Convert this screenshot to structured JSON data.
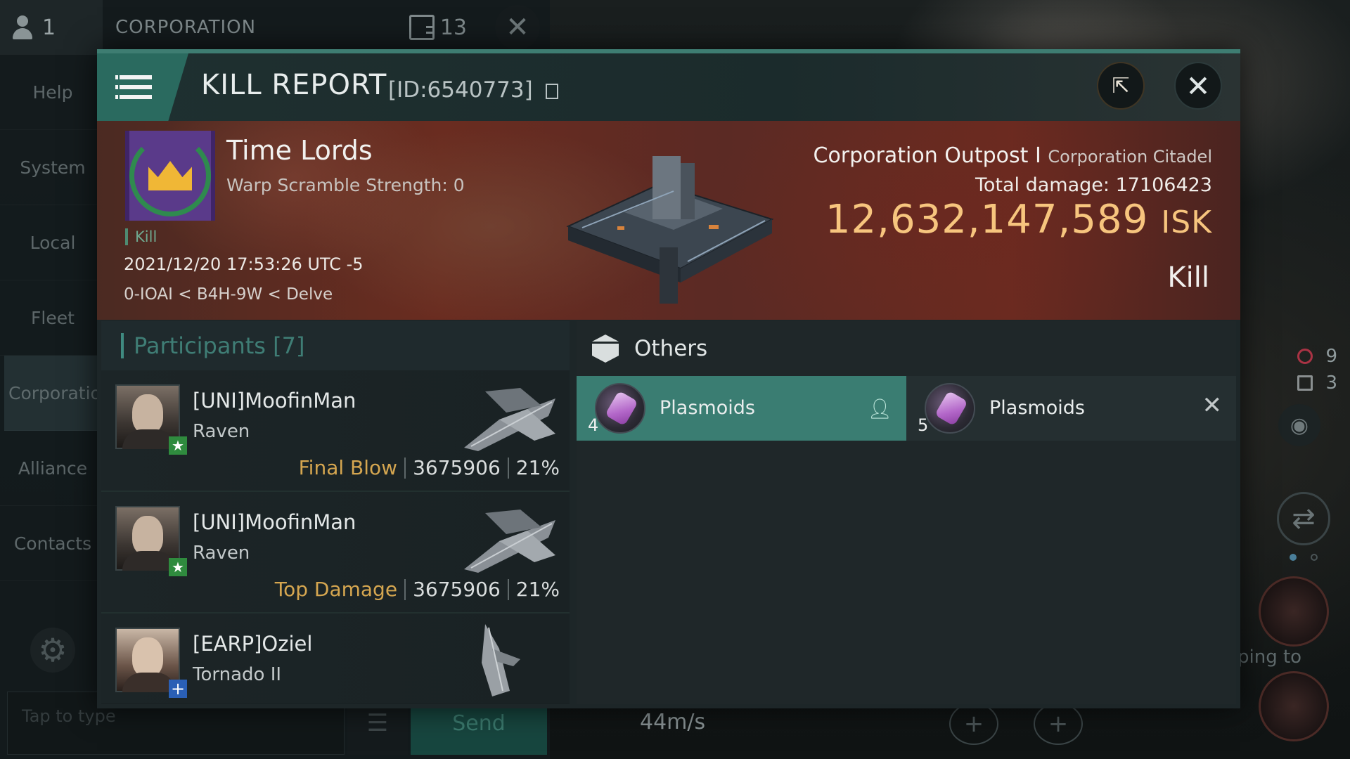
{
  "channel": {
    "member_count": "1",
    "title": "CORPORATION",
    "message_count": "13"
  },
  "side_nav": [
    "Help",
    "System",
    "Local",
    "Fleet",
    "Corporation",
    "Alliance",
    "Contacts"
  ],
  "chat": {
    "placeholder": "Tap to type",
    "send_label": "Send"
  },
  "hud": {
    "counter_red": "9",
    "counter_grey": "3",
    "speed": "44m/s",
    "jump_text": "ping to"
  },
  "report": {
    "title": "KILL REPORT",
    "id_text": "[ID:6540773]",
    "victim": {
      "name": "Time Lords",
      "warp_scramble": "Warp Scramble Strength: 0",
      "tag": "Kill",
      "time": "2021/12/20 17:53:26 UTC -5",
      "location": "0-IOAI < B4H-9W < Delve"
    },
    "target": {
      "name": "Corporation Outpost I",
      "type": "Corporation Citadel",
      "total_damage_label": "Total damage:",
      "total_damage": "17106423",
      "isk_value": "12,632,147,589",
      "isk_unit": "ISK",
      "result": "Kill"
    },
    "participants": {
      "label": "Participants [7]",
      "rows": [
        {
          "name": "[UNI]MoofinMan",
          "ship": "Raven",
          "role": "Final Blow",
          "damage": "3675906",
          "percent": "21%",
          "badge": "star"
        },
        {
          "name": "[UNI]MoofinMan",
          "ship": "Raven",
          "role": "Top Damage",
          "damage": "3675906",
          "percent": "21%",
          "badge": "star"
        },
        {
          "name": "[EARP]Oziel",
          "ship": "Tornado II",
          "badge": "plus"
        }
      ]
    },
    "others": {
      "label": "Others",
      "items": [
        {
          "name": "Plasmoids",
          "qty": "4",
          "status": "dropped"
        },
        {
          "name": "Plasmoids",
          "qty": "5",
          "status": "destroyed"
        }
      ]
    }
  },
  "colors": {
    "accent_teal": "#3a7d72",
    "isk_gold": "#f7c57e",
    "role_gold": "#d5a650",
    "banner_red": "#6a2c20"
  }
}
